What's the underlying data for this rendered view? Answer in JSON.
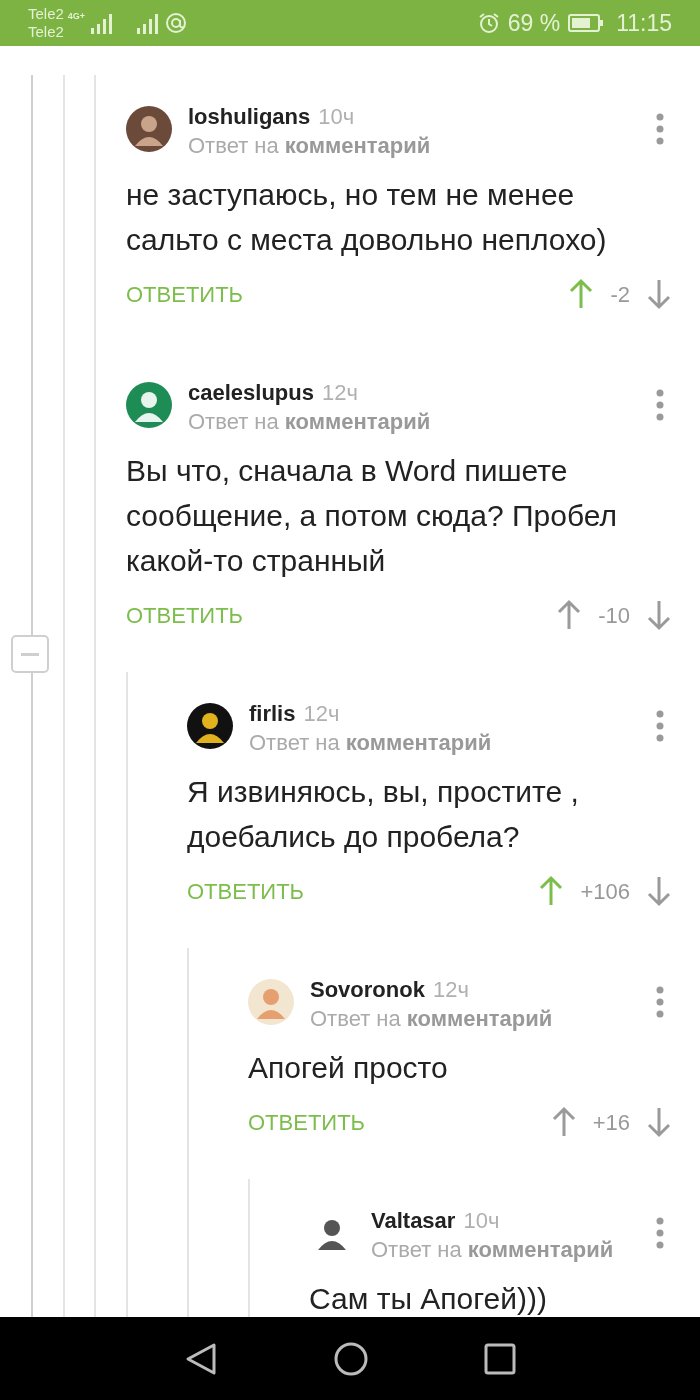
{
  "status_bar": {
    "carrier_1": "Tele2",
    "carrier_2": "Tele2",
    "network": "4G+",
    "battery": "69 %",
    "time": "11:15"
  },
  "comments": [
    {
      "username": "loshuligans",
      "time": "10ч",
      "reply_label": "Ответ на **комментарий**",
      "text": "не заступаюсь, но тем не менее сальто с места довольно неплохо)",
      "reply_button": "ОТВЕТИТЬ",
      "score": "-2",
      "upvoted": true
    },
    {
      "username": "caeleslupus",
      "time": "12ч",
      "reply_label": "Ответ на **комментарий**",
      "text": "Вы что, сначала в Word пишете сообщение, а потом сюда? Пробел какой-то странный",
      "reply_button": "ОТВЕТИТЬ",
      "score": "-10",
      "upvoted": false,
      "expanded": true,
      "children": [
        {
          "username": "firlis",
          "time": "12ч",
          "reply_label": "Ответ на **комментарий**",
          "text": "Я извиняюсь, вы, простите , доебались до пробела?",
          "reply_button": "ОТВЕТИТЬ",
          "score": "+106",
          "upvoted": true,
          "children": [
            {
              "username": "Sovoronok",
              "time": "12ч",
              "reply_label": "Ответ на **комментарий**",
              "text": "Апогей просто",
              "reply_button": "ОТВЕТИТЬ",
              "score": "+16",
              "upvoted": false,
              "children": [
                {
                  "username": "Valtasar",
                  "time": "10ч",
                  "reply_label": "Ответ на **комментарий**",
                  "text": "Сам ты Апогей)))"
                }
              ]
            }
          ]
        }
      ]
    }
  ]
}
